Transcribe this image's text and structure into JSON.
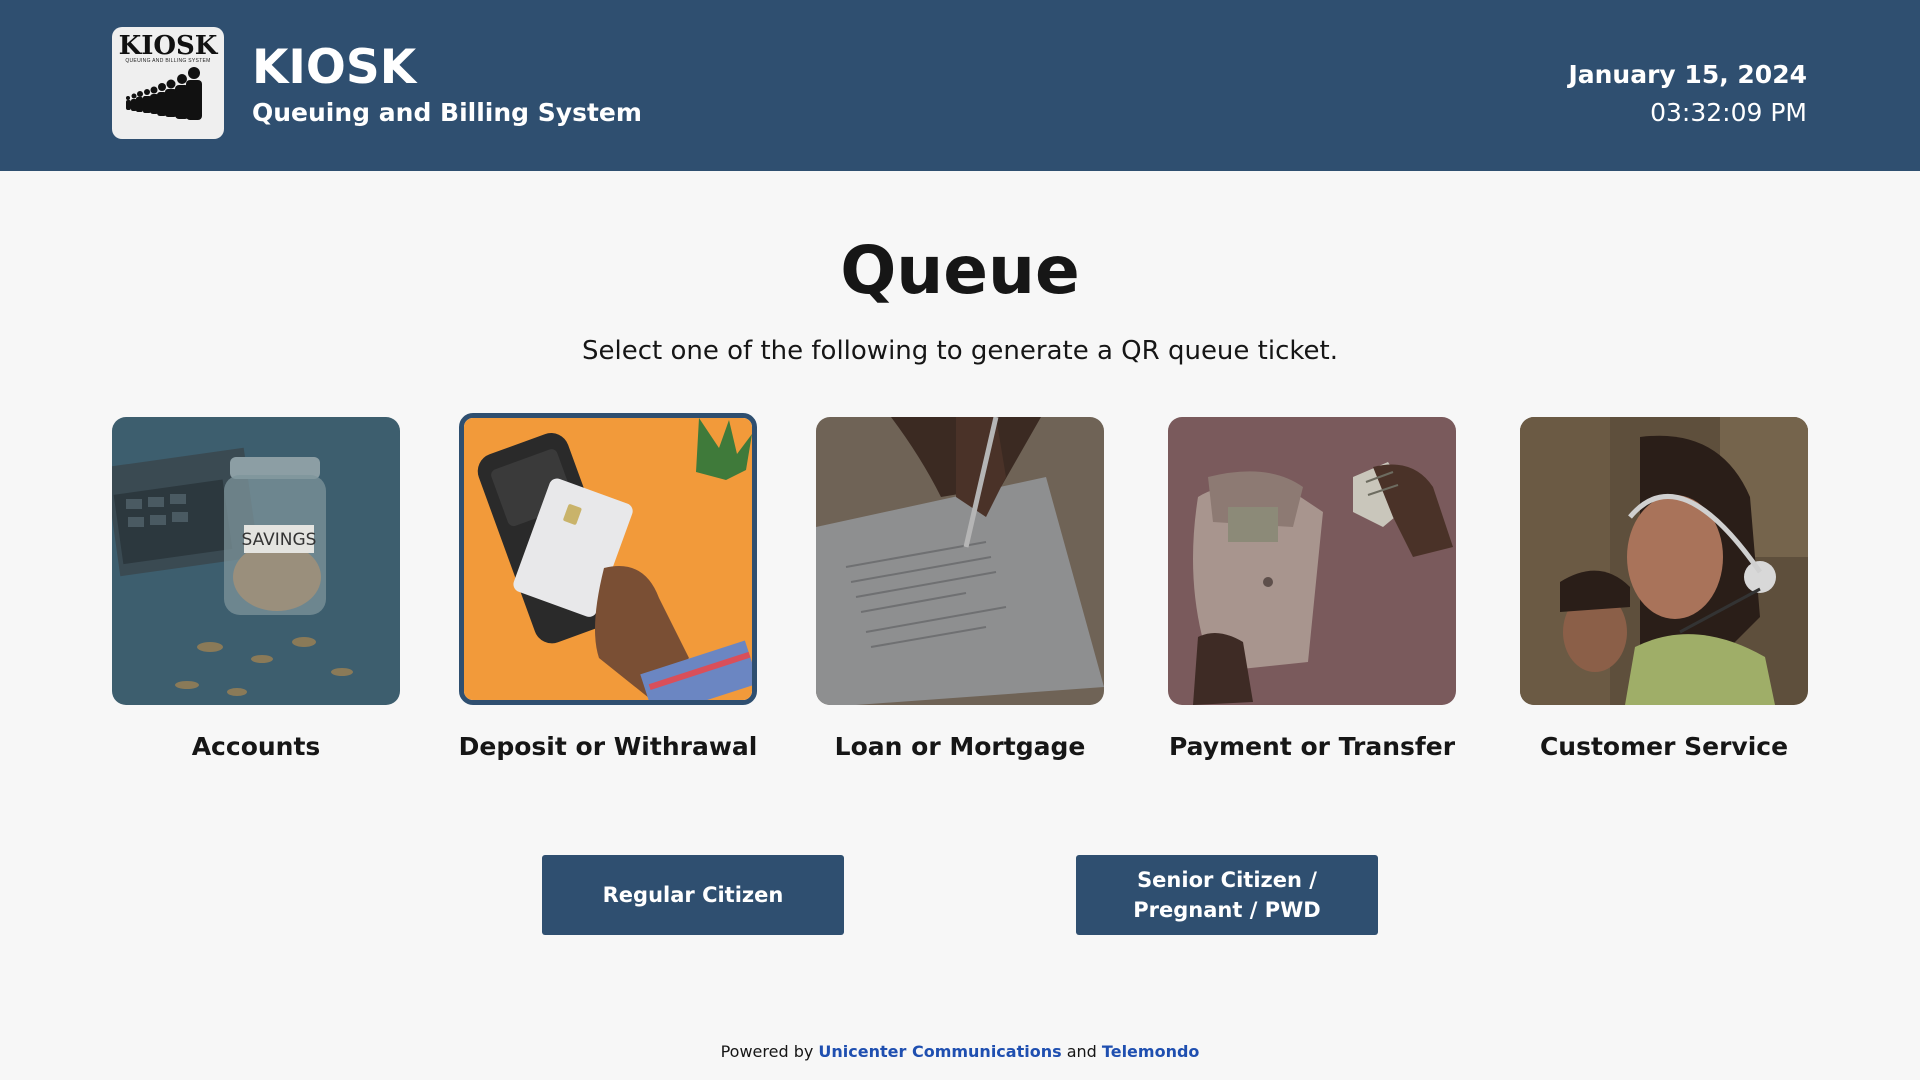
{
  "header": {
    "logo": {
      "title": "KIOSK",
      "subtitle": "QUEUING AND BILLING SYSTEM",
      "icon": "queue-people-icon"
    },
    "app_name": "KIOSK",
    "app_subtitle": "Queuing and Billing System",
    "date": "January 15, 2024",
    "time": "03:32:09 PM"
  },
  "main": {
    "title": "Queue",
    "subtitle": "Select one of the following to generate a QR queue ticket.",
    "services": [
      {
        "label": "Accounts",
        "image": "savings-jar-image",
        "selected": false
      },
      {
        "label": "Deposit or Withrawal",
        "image": "card-payment-terminal-image",
        "selected": true
      },
      {
        "label": "Loan or Mortgage",
        "image": "signing-document-image",
        "selected": false
      },
      {
        "label": "Payment or Transfer",
        "image": "wallet-cash-image",
        "selected": false
      },
      {
        "label": "Customer Service",
        "image": "call-center-agent-image",
        "selected": false
      }
    ],
    "buttons": {
      "regular": "Regular Citizen",
      "priority_line1": "Senior Citizen /",
      "priority_line2": "Pregnant / PWD"
    }
  },
  "footer": {
    "prefix": "Powered by",
    "company1": "Unicenter Communications",
    "joiner": "and",
    "company2": "Telemondo"
  },
  "colors": {
    "header_bg": "#2f4f70",
    "button_bg": "#2f4f70",
    "page_bg": "#f7f7f7",
    "link": "#1f4fb0",
    "deposit_card_bg": "#f29a3a"
  }
}
